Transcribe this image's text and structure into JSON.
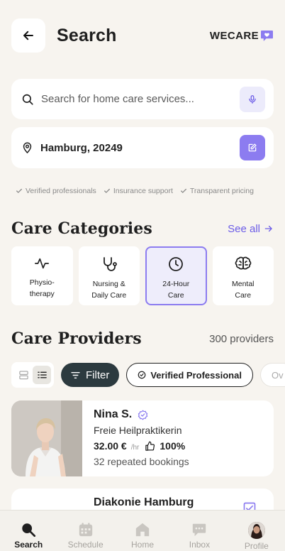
{
  "header": {
    "title": "Search",
    "logo_text": "WECARE"
  },
  "search": {
    "placeholder": "Search for home care services..."
  },
  "location": {
    "value": "Hamburg, 20249"
  },
  "trust_badges": [
    "Verified professionals",
    "Insurance support",
    "Transparent pricing"
  ],
  "categories_section": {
    "title": "Care Categories",
    "see_all_label": "See all",
    "items": [
      {
        "line1": "Physio-",
        "line2": "therapy",
        "icon": "pulse-icon"
      },
      {
        "line1": "Nursing &",
        "line2": "Daily Care",
        "icon": "stethoscope-icon"
      },
      {
        "line1": "24-Hour",
        "line2": "Care",
        "icon": "clock-icon",
        "selected": true
      },
      {
        "line1": "Mental",
        "line2": "Care",
        "icon": "brain-icon"
      }
    ]
  },
  "providers_section": {
    "title": "Care Providers",
    "count_label": "300 providers"
  },
  "filters": {
    "filter_label": "Filter",
    "chips": [
      "Verified Professional",
      "Ov"
    ]
  },
  "providers": [
    {
      "name": "Nina S.",
      "role": "Freie Heilpraktikerin",
      "price": "32.00 €",
      "unit": "/hr",
      "rating": "100%",
      "bookings": "32 repeated bookings",
      "verified": true
    },
    {
      "name": "Diakonie Hamburg"
    }
  ],
  "bottom_nav": [
    {
      "label": "Search",
      "icon": "search-icon",
      "active": true
    },
    {
      "label": "Schedule",
      "icon": "calendar-icon"
    },
    {
      "label": "Home",
      "icon": "home-icon"
    },
    {
      "label": "Inbox",
      "icon": "chat-icon"
    },
    {
      "label": "Profile",
      "icon": "avatar-icon"
    }
  ],
  "colors": {
    "accent": "#8c7cf0",
    "link": "#6c5ce7",
    "dark_button": "#2c3a3f",
    "background": "#f7f4ef"
  }
}
